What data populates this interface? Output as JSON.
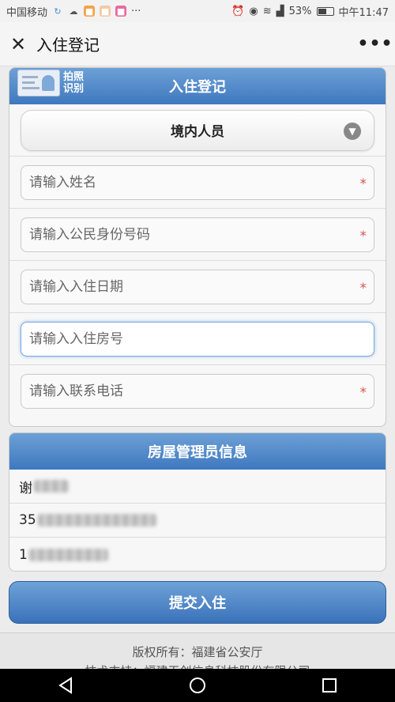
{
  "status_bar": {
    "carrier": "中国移动",
    "battery": "53%",
    "battery_level": 0.53,
    "time": "中午11:47"
  },
  "nav": {
    "title": "入住登记",
    "more": "•••"
  },
  "form": {
    "photo_label": "拍照识别",
    "header": "入住登记",
    "person_type": "境内人员",
    "fields": [
      {
        "placeholder": "请输入姓名",
        "required": true
      },
      {
        "placeholder": "请输入公民身份号码",
        "required": true
      },
      {
        "placeholder": "请输入入住日期",
        "required": true
      },
      {
        "placeholder": "请输入入住房号",
        "required": false
      },
      {
        "placeholder": "请输入联系电话",
        "required": true
      }
    ],
    "required_mark": "*"
  },
  "manager": {
    "header": "房屋管理员信息",
    "name_prefix": "谢",
    "id_prefix": "35",
    "phone_prefix": "1"
  },
  "actions": {
    "submit_label": "提交入住"
  },
  "footer": {
    "copyright": "版权所有：福建省公安厅",
    "support": "技术支持：福建天创信息科技股份有限公司"
  },
  "icons": {
    "close": "close-icon",
    "more": "more-icon",
    "chevron": "chevron-down-icon",
    "back": "back-icon",
    "home": "home-icon",
    "recents": "recents-icon"
  },
  "colors": {
    "header_blue": "#4f86c6",
    "required_red": "#d9534f"
  }
}
